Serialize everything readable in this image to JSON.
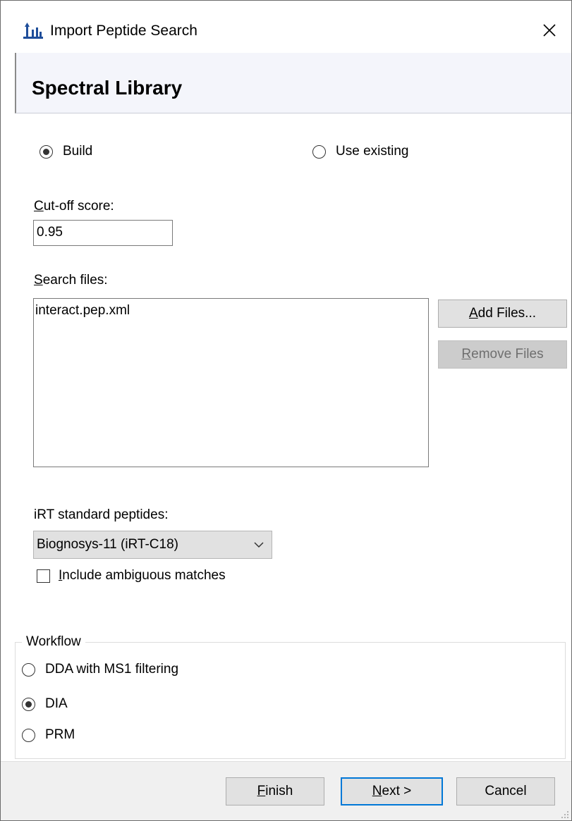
{
  "window": {
    "title": "Import Peptide Search",
    "icon": "skyline-peaks-icon",
    "close_icon": "close-icon",
    "accent_color": "#0078d7"
  },
  "header": {
    "title": "Spectral Library"
  },
  "library_mode": {
    "options": [
      {
        "label": "Build",
        "selected": true
      },
      {
        "label": "Use existing",
        "selected": false
      }
    ]
  },
  "cutoff": {
    "label_mnemonic": "C",
    "label_rest": "ut-off score:",
    "value": "0.95"
  },
  "search_files": {
    "label_mnemonic": "S",
    "label_rest": "earch files:",
    "items": [
      "interact.pep.xml"
    ],
    "add_mnemonic": "A",
    "add_rest": "dd Files...",
    "remove_mnemonic": "R",
    "remove_rest": "emove Files"
  },
  "irt": {
    "label": "iRT standard peptides:",
    "selected": "Biognosys-11 (iRT-C18)",
    "include_mnemonic": "I",
    "include_rest": "nclude ambiguous matches",
    "include_checked": false
  },
  "workflow": {
    "legend": "Workflow",
    "options": [
      {
        "label": "DDA with MS1 filtering",
        "selected": false
      },
      {
        "label": "DIA",
        "selected": true
      },
      {
        "label": "PRM",
        "selected": false
      }
    ]
  },
  "footer": {
    "finish_mnemonic": "F",
    "finish_rest": "inish",
    "next_mnemonic": "N",
    "next_rest": "ext >",
    "cancel": "Cancel"
  }
}
